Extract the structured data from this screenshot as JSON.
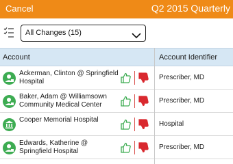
{
  "topbar": {
    "cancel_label": "Cancel",
    "title": "Q2 2015 Quarterly"
  },
  "filter": {
    "icon": "checklist-icon",
    "selected": "All Changes (15)"
  },
  "table": {
    "headers": {
      "account": "Account",
      "identifier": "Account Identifier"
    },
    "rows": [
      {
        "name": "Ackerman, Clinton @ Springfield Hospital",
        "type": "person",
        "identifier": "Prescriber, MD"
      },
      {
        "name": "Baker, Adam @ Williamsown Community Medical Center",
        "type": "person",
        "identifier": "Prescriber, MD"
      },
      {
        "name": "Cooper Memorial Hospital",
        "type": "institution",
        "identifier": "Hospital"
      },
      {
        "name": "Edwards, Katherine @ Springfield Hospital",
        "type": "person",
        "identifier": "Prescriber, MD"
      }
    ]
  },
  "colors": {
    "accent": "#ef8a17",
    "approve": "#3dac52",
    "reject": "#d9292f",
    "header_bg": "#d6e7f4"
  }
}
